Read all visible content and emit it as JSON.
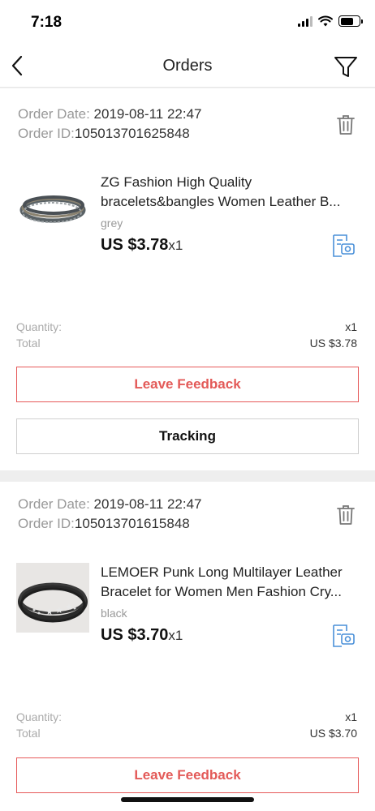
{
  "status_bar": {
    "time": "7:18"
  },
  "nav": {
    "title": "Orders"
  },
  "labels": {
    "order_date": "Order Date:",
    "order_id": "Order ID:",
    "quantity": "Quantity:",
    "total": "Total"
  },
  "orders": [
    {
      "order_date": "2019-08-11 22:47",
      "order_id": "105013701625848",
      "title_line1": "ZG  Fashion High Quality",
      "title_line2": "bracelets&bangles Women Leather B...",
      "variant": "grey",
      "price": "US $3.78",
      "qty": "x1",
      "quantity_value": "x1",
      "total_value": "US $3.78",
      "btn_feedback": "Leave Feedback",
      "btn_tracking": "Tracking"
    },
    {
      "order_date": "2019-08-11 22:47",
      "order_id": "105013701615848",
      "title_line1": "LEMOER Punk Long Multilayer Leather",
      "title_line2": "Bracelet for Women Men Fashion Cry...",
      "variant": "black",
      "price": "US $3.70",
      "qty": "x1",
      "quantity_value": "x1",
      "total_value": "US $3.70",
      "btn_feedback": "Leave Feedback"
    }
  ],
  "icons": {
    "back": "chevron-left-icon",
    "filter": "filter-icon",
    "delete": "trash-icon",
    "photo_review": "photo-review-icon"
  },
  "colors": {
    "accent": "#e35a58",
    "link_blue": "#4a90d9"
  }
}
